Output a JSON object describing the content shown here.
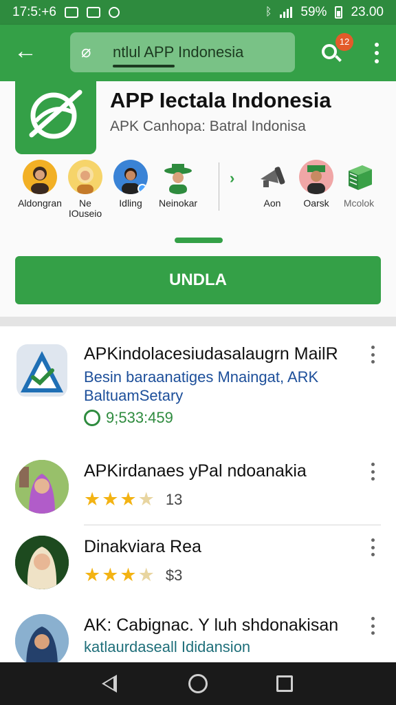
{
  "status_bar": {
    "time": "17:5:+6",
    "battery": "59%",
    "clock_right": "23.00",
    "icons": [
      "mail-icon",
      "image-icon",
      "location-icon",
      "bluetooth-icon",
      "signal-icon",
      "battery-icon"
    ]
  },
  "app_bar": {
    "back_icon": "arrow-left-icon",
    "search_value": "ntlul APP Indonesia",
    "notification_count": "12",
    "colors": {
      "primary": "#34a047",
      "status": "#2e8b3e",
      "search_bg": "#79c286",
      "badge": "#e35b2a"
    }
  },
  "header": {
    "title": "APP Iectala Indonesia",
    "subtitle": "APK Canhopa: Batral Indonisa",
    "avatars": [
      {
        "label": "Aldongran",
        "icon": "person-icon"
      },
      {
        "label": "Ne\nIOuseio",
        "icon": "person-icon"
      },
      {
        "label": "Idling",
        "icon": "person-icon"
      },
      {
        "label": "Neinokar",
        "icon": "person-icon"
      },
      {
        "label": "Aon",
        "icon": "megaphone-icon"
      },
      {
        "label": "Oarsk",
        "icon": "person-icon"
      },
      {
        "label": "Mcolok",
        "icon": "box-icon"
      }
    ],
    "install_label": "UNDLA"
  },
  "list": [
    {
      "title": "APKindolacesiudasalaugrn MailR",
      "description": "Besin baraanatiges Mnaingat, ARK BaltuamSetary",
      "downloads": "9;533:459",
      "icon": "shield-check-icon"
    },
    {
      "title": "APKirdanaes yPal ndoanakia",
      "rating": 3.5,
      "rating_text": "13"
    },
    {
      "title": "Dinakviara Rea",
      "rating": 3.5,
      "rating_text": "$3"
    },
    {
      "title": "AK: Cabignac. Y luh shdonakisan",
      "description": "katlaurdaseall Ididansion"
    }
  ]
}
